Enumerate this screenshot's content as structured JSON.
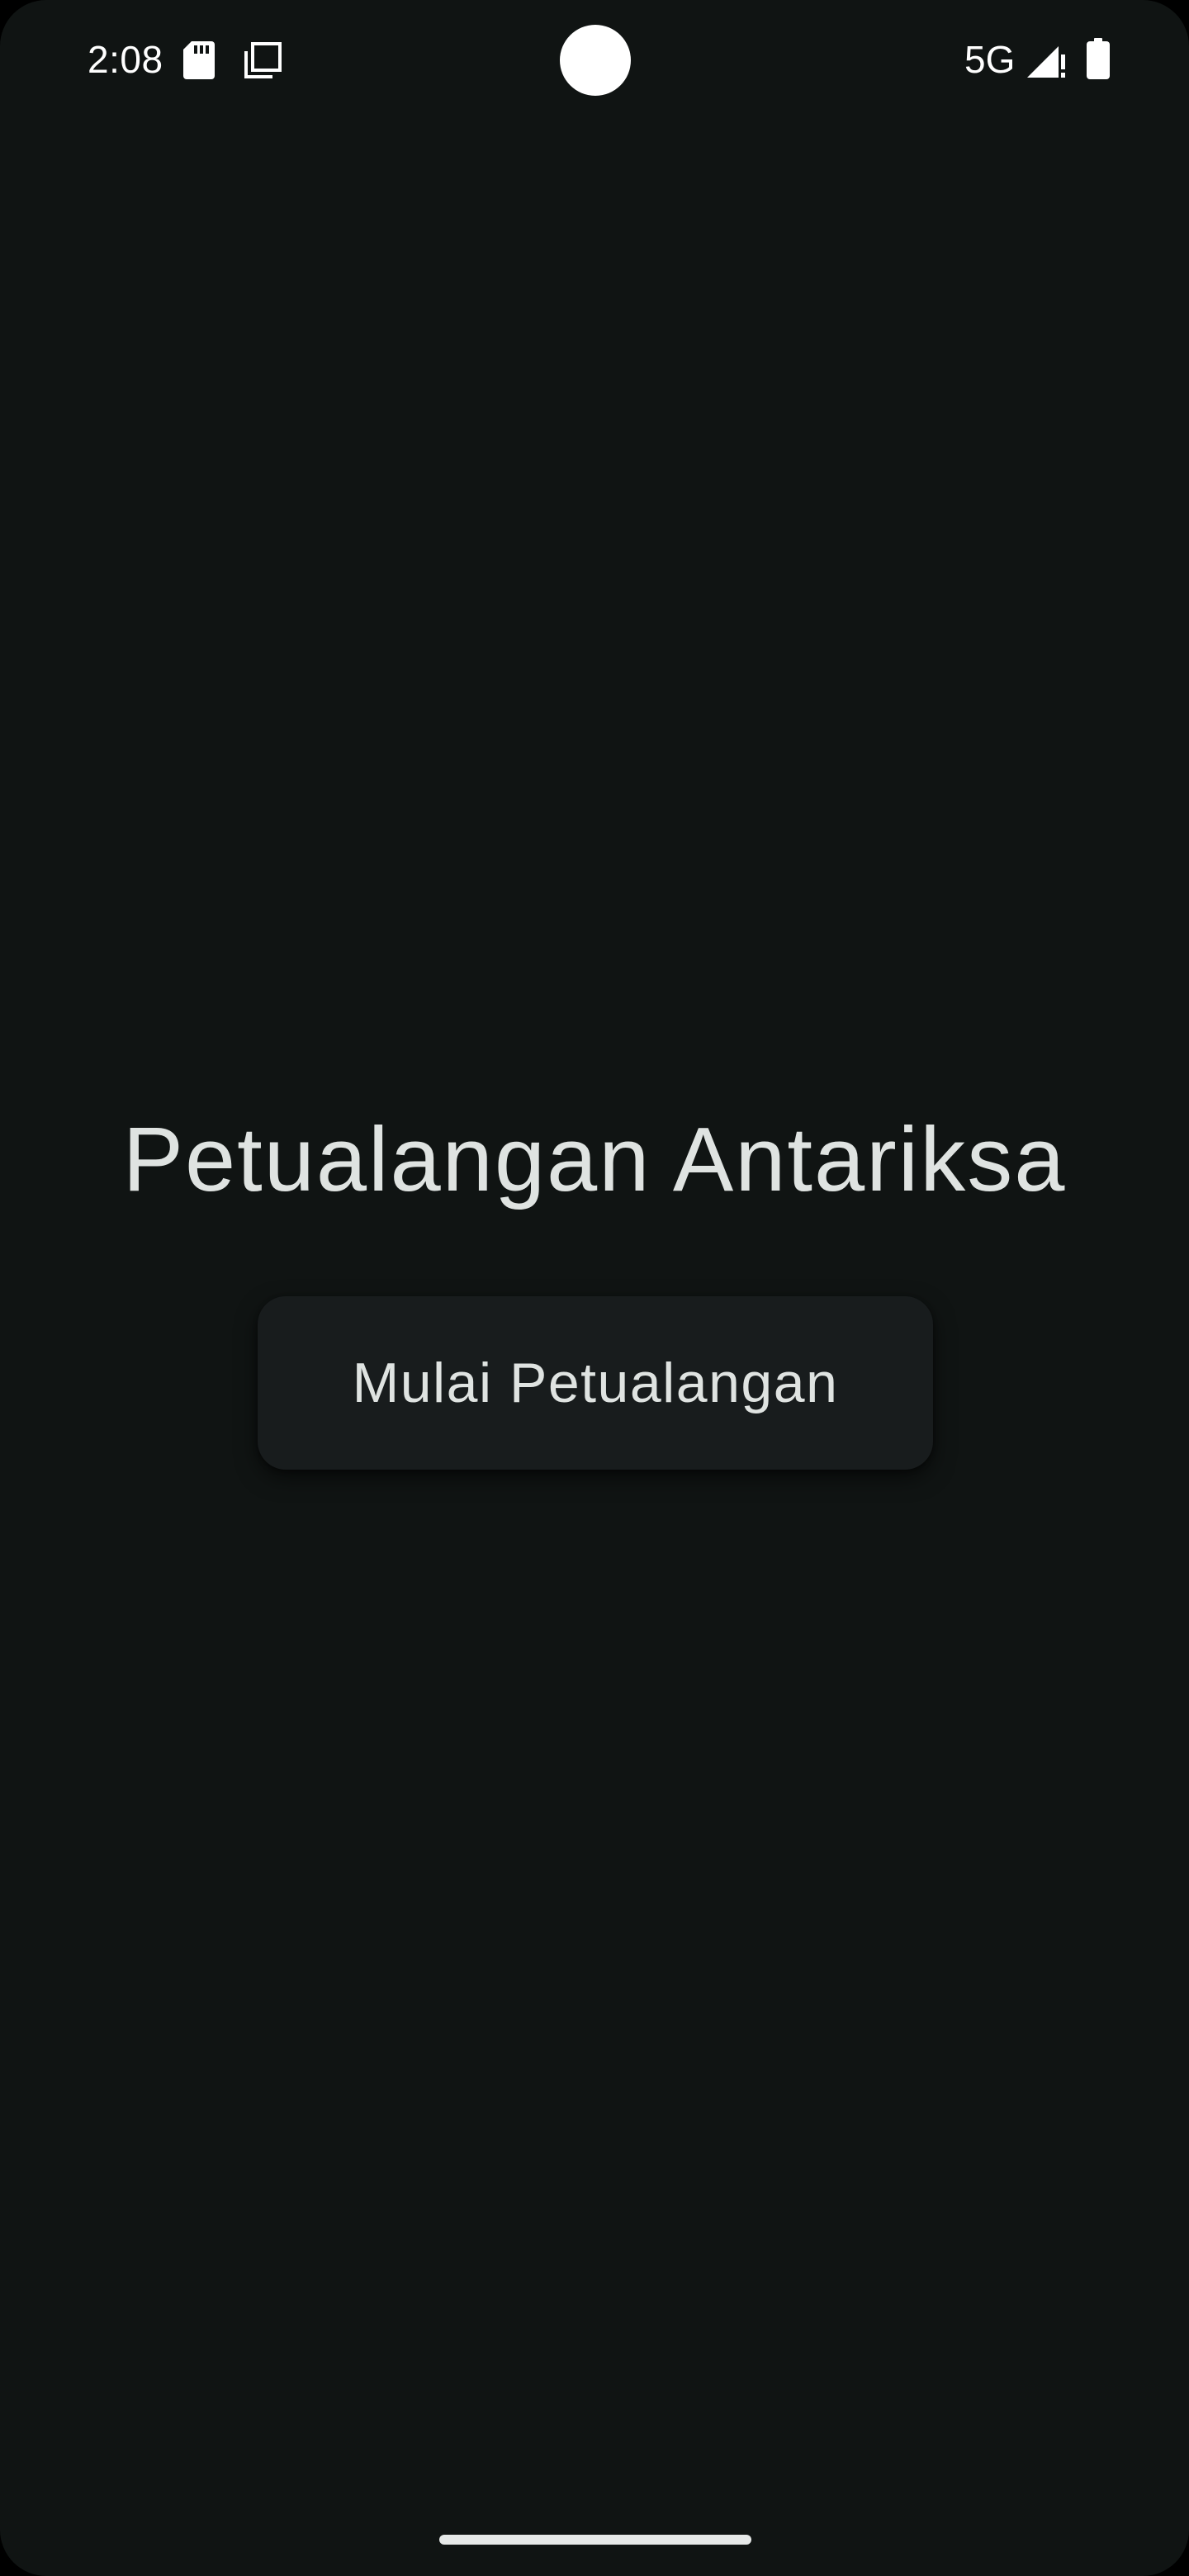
{
  "status_bar": {
    "time": "2:08",
    "network": "5G",
    "icons": [
      "sd-card-icon",
      "layers-icon",
      "signal-icon",
      "battery-icon"
    ]
  },
  "main": {
    "title": "Petualangan Antariksa",
    "start_button_label": "Mulai Petualangan"
  },
  "colors": {
    "background": "#101413",
    "button_background": "#181c1d",
    "text": "#dfe3e1",
    "status_text": "#ffffff"
  }
}
